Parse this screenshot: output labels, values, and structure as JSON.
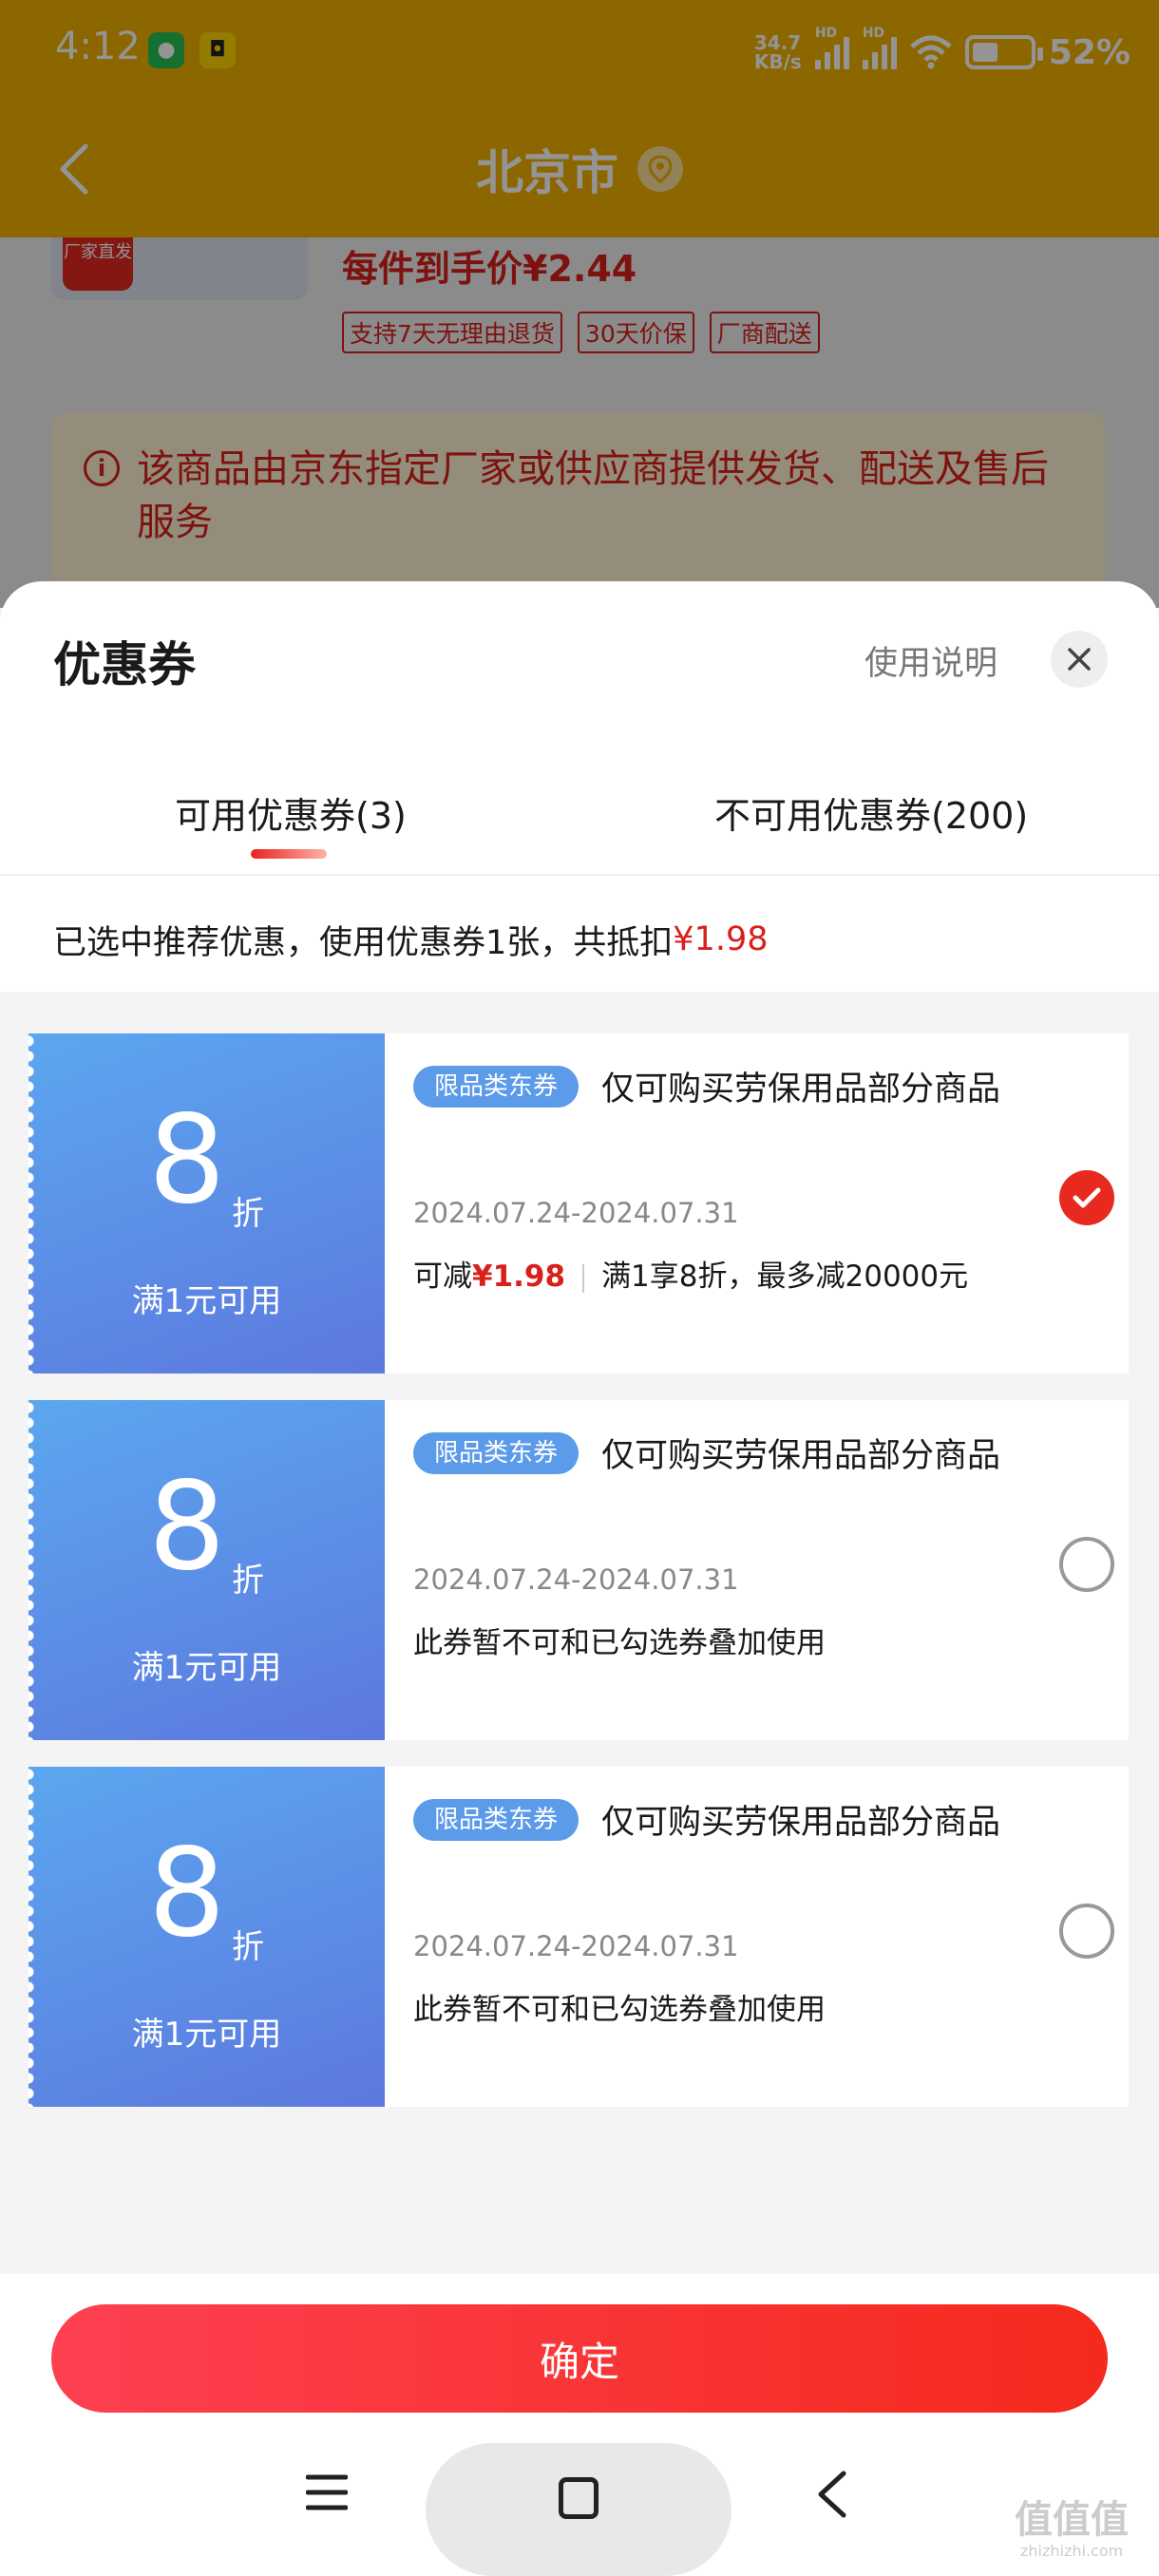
{
  "status_bar": {
    "time": "4:12",
    "net_speed_value": "34.7",
    "net_speed_unit": "KB/s",
    "hd1": "HD",
    "hd2": "HD",
    "battery": "52%"
  },
  "nav": {
    "title": "北京市"
  },
  "background": {
    "product_badge": "厂家直发",
    "price_line": "每件到手价¥2.44",
    "tags": [
      "支持7天无理由退货",
      "30天价保",
      "厂商配送"
    ],
    "notice": "该商品由京东指定厂家或供应商提供发货、配送及售后服务"
  },
  "sheet": {
    "title": "优惠券",
    "usage_link": "使用说明",
    "tabs": [
      {
        "label": "可用优惠券(3)",
        "active": true
      },
      {
        "label": "不可用优惠券(200)",
        "active": false
      }
    ],
    "summary_prefix": "已选中推荐优惠，使用优惠券1张，共抵扣",
    "summary_amount": "¥1.98",
    "coupons": [
      {
        "discount": "8",
        "unit": "折",
        "condition": "满1元可用",
        "tag": "限品类东券",
        "desc": "仅可购买劳保用品部分商品",
        "date": "2024.07.24-2024.07.31",
        "line_prefix": "可减",
        "line_amount": "¥1.98",
        "line_rest": "满1享8折，最多减20000元",
        "checked": true
      },
      {
        "discount": "8",
        "unit": "折",
        "condition": "满1元可用",
        "tag": "限品类东券",
        "desc": "仅可购买劳保用品部分商品",
        "date": "2024.07.24-2024.07.31",
        "note": "此券暂不可和已勾选券叠加使用",
        "checked": false
      },
      {
        "discount": "8",
        "unit": "折",
        "condition": "满1元可用",
        "tag": "限品类东券",
        "desc": "仅可购买劳保用品部分商品",
        "date": "2024.07.24-2024.07.31",
        "note": "此券暂不可和已勾选券叠加使用",
        "checked": false
      }
    ],
    "confirm": "确定"
  },
  "watermark": {
    "text": "值值值",
    "sub": "zhizhizhi.com"
  },
  "colors": {
    "brand_yellow": "#f2b200",
    "accent_red": "#e7291e",
    "coupon_blue": "#5c9be9"
  }
}
